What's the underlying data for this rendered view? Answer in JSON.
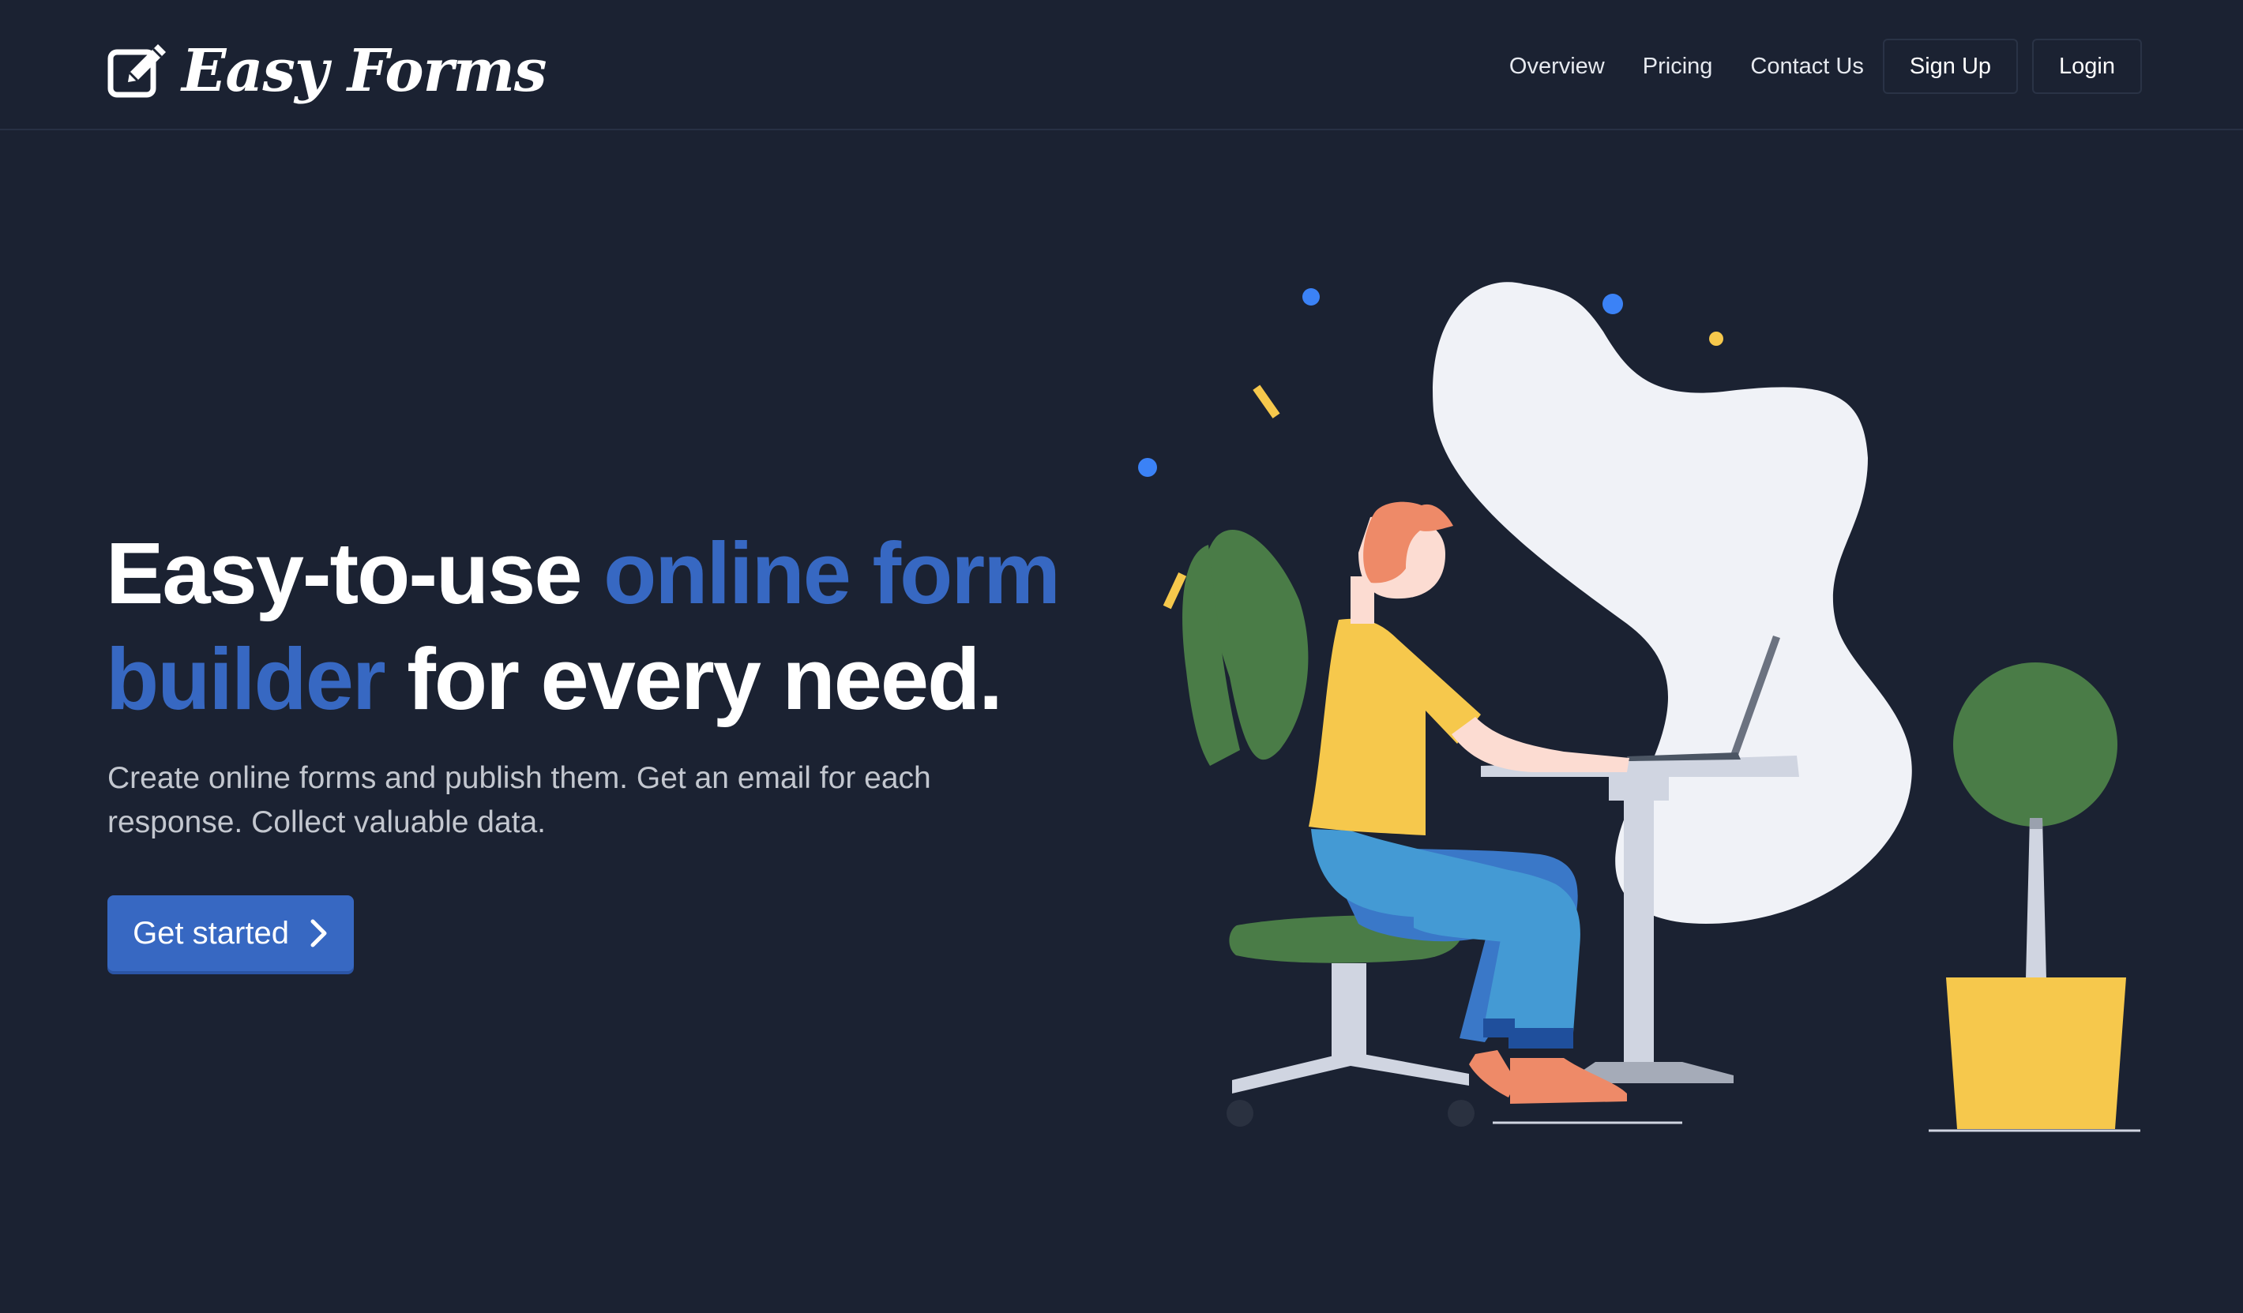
{
  "brand": {
    "name": "Easy Forms",
    "icon": "edit-square-icon"
  },
  "nav": {
    "links": [
      {
        "label": "Overview"
      },
      {
        "label": "Pricing"
      },
      {
        "label": "Contact Us"
      }
    ],
    "signup_label": "Sign Up",
    "login_label": "Login"
  },
  "hero": {
    "title_part1": "Easy-to-use ",
    "title_accent": "online form builder",
    "title_part2": " for every need.",
    "subtitle": "Create online forms and publish them. Get an email for each response. Collect valuable data.",
    "cta_label": "Get started",
    "cta_icon": "chevron-right-icon"
  },
  "colors": {
    "background": "#1b2232",
    "accent": "#3768c2",
    "plant_green": "#4a7c47",
    "shirt_yellow": "#f6c84c",
    "pants_blue": "#449ad4",
    "skin": "#fcdcd2",
    "hair": "#ee8a68"
  }
}
